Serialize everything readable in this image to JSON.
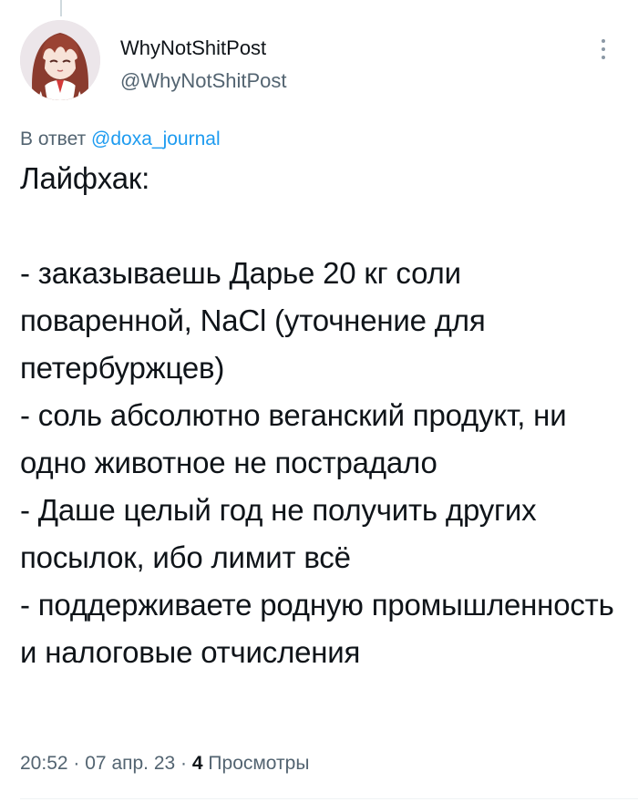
{
  "author": {
    "display_name": "WhyNotShitPost",
    "handle": "@WhyNotShitPost",
    "avatar_icon": "anime-avatar"
  },
  "reply": {
    "prefix": "В ответ",
    "mention": "@doxa_journal"
  },
  "tweet": {
    "text": "Лайфхак:\n\n- заказываешь Дарье 20 кг соли поваренной, NaCl (уточнение для петербуржцев)\n- соль абсолютно веганский продукт, ни одно животное не пострадало\n- Даше целый год не получить других посылок, ибо лимит всё\n- поддерживаете родную промышленность и налоговые отчисления"
  },
  "meta": {
    "time": "20:52",
    "date": "07 апр. 23",
    "separator": "·",
    "views_count": "4",
    "views_label": "Просмотры"
  },
  "icons": {
    "more": "more-vertical-icon"
  },
  "colors": {
    "text": "#0f1419",
    "secondary": "#536471",
    "link": "#1d9bf0",
    "divider": "#eff3f4"
  }
}
